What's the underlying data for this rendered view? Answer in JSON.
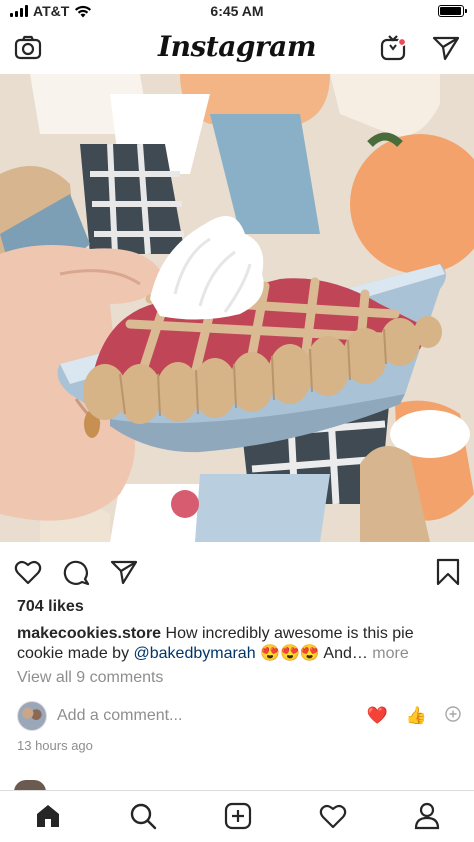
{
  "status_bar": {
    "carrier": "AT&T",
    "time": "6:45 AM",
    "battery_level": 0.95
  },
  "header": {
    "logo": "Instagram",
    "icons": [
      "camera-icon",
      "igtv-icon",
      "direct-message-icon"
    ]
  },
  "post": {
    "image_alt": "pie cookie",
    "likes": "704 likes",
    "caption": {
      "username": "makecookies.store",
      "text_before": " How incredibly awesome is this pie cookie made by ",
      "mention": "@bakedbymarah",
      "emojis": " 😍😍😍 ",
      "text_after": "And…",
      "more": " more"
    },
    "view_comments": "View all 9 comments",
    "add_comment_placeholder": "Add a comment...",
    "quick_reactions": [
      "❤️",
      "👍"
    ],
    "timestamp": "13 hours ago"
  },
  "tab_bar": {
    "items": [
      "home-tab",
      "search-tab",
      "new-post-tab",
      "activity-tab",
      "profile-tab"
    ]
  },
  "colors": {
    "text": "#262626",
    "secondary": "#8e8e8e",
    "mention": "#003569",
    "notification_dot": "#ed4956"
  }
}
